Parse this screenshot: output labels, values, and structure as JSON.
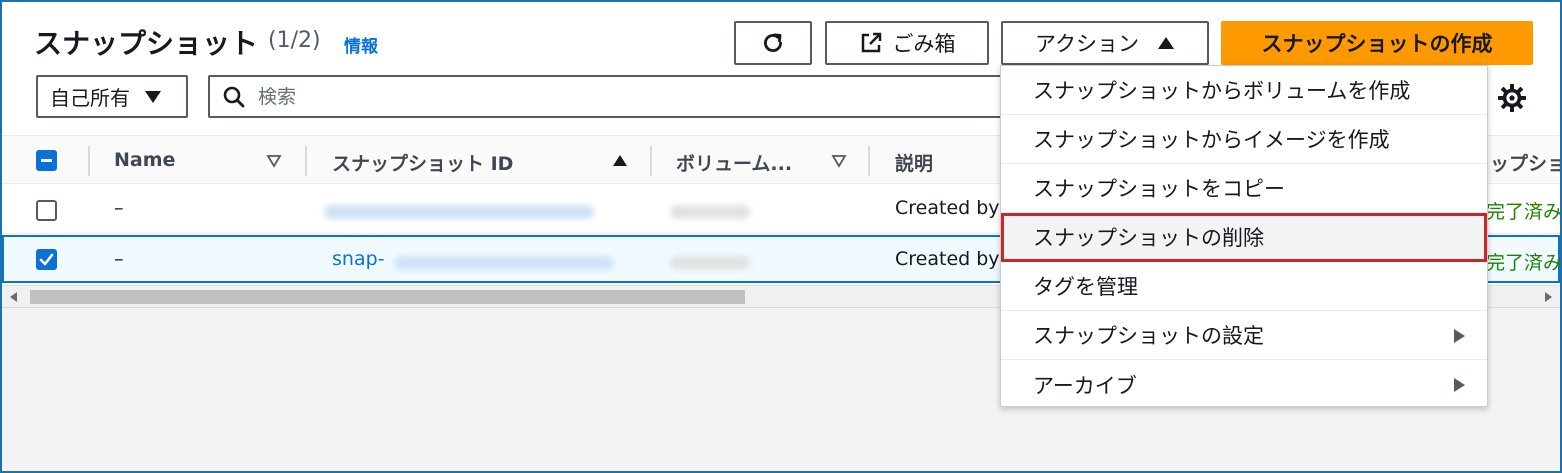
{
  "header": {
    "title": "スナップショット",
    "count": "(1/2)",
    "info_link": "情報"
  },
  "toolbar": {
    "trash_label": "ごみ箱",
    "actions_label": "アクション",
    "create_label": "スナップショットの作成"
  },
  "filter": {
    "owner_label": "自己所有",
    "search_placeholder": "検索"
  },
  "table": {
    "columns": [
      "Name",
      "スナップショット ID",
      "ボリューム...",
      "説明",
      "ップショ"
    ],
    "rows": [
      {
        "name": "–",
        "snapshot_id": "",
        "description": "Created by",
        "status": "完了済み",
        "selected": false
      },
      {
        "name": "–",
        "snapshot_id": "snap-",
        "description": "Created by",
        "status": "完了済み",
        "selected": true
      }
    ]
  },
  "actions_menu": {
    "items": [
      {
        "label": "スナップショットからボリュームを作成",
        "submenu": false,
        "highlighted": false
      },
      {
        "label": "スナップショットからイメージを作成",
        "submenu": false,
        "highlighted": false
      },
      {
        "label": "スナップショットをコピー",
        "submenu": false,
        "highlighted": false
      },
      {
        "label": "スナップショットの削除",
        "submenu": false,
        "highlighted": true
      },
      {
        "label": "タグを管理",
        "submenu": false,
        "highlighted": false
      },
      {
        "label": "スナップショットの設定",
        "submenu": true,
        "highlighted": false
      },
      {
        "label": "アーカイブ",
        "submenu": true,
        "highlighted": false
      }
    ]
  },
  "colors": {
    "primary": "#ff9900",
    "link": "#0972d3",
    "success": "#1d8102",
    "highlight_border": "#c62828"
  },
  "icons": {
    "refresh": "refresh-icon",
    "trash": "external-link-icon",
    "actions_caret": "caret-up-icon",
    "owner_caret": "caret-down-icon",
    "search": "search-icon",
    "preferences": "gear-icon"
  }
}
